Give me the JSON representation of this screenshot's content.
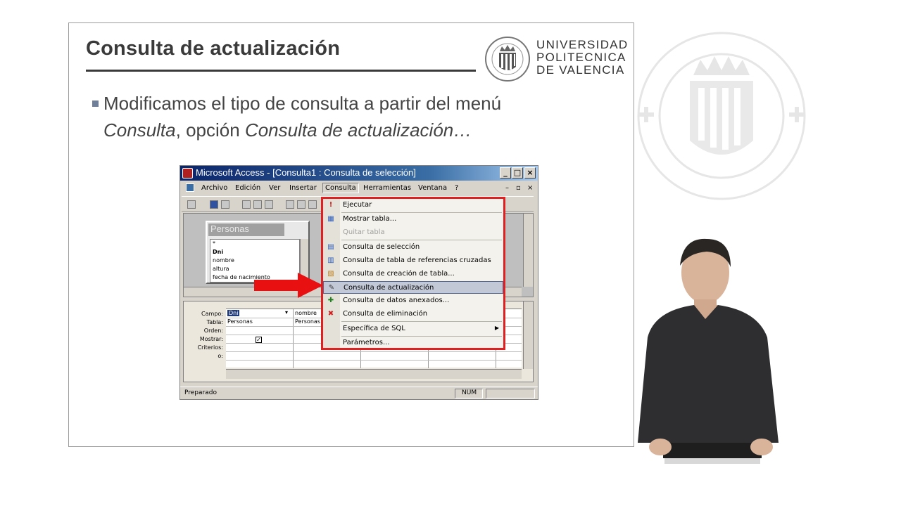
{
  "slide": {
    "title": "Consulta de actualización",
    "university": {
      "line1": "UNIVERSIDAD",
      "line2": "POLITECNICA",
      "line3": "DE VALENCIA"
    },
    "bullet": {
      "part1": "Modificamos el tipo de consulta a partir del menú",
      "menu_name": "Consulta",
      "part2": ", opción",
      "option_name": "Consulta de actualización…"
    }
  },
  "access": {
    "window_title": "Microsoft Access - [Consulta1 : Consulta de selección]",
    "window_buttons": {
      "minimize": "_",
      "maximize": "□",
      "close": "×"
    },
    "menubar": [
      "Archivo",
      "Edición",
      "Ver",
      "Insertar",
      "Consulta",
      "Herramientas",
      "Ventana",
      "?"
    ],
    "active_menu": "Consulta",
    "table_box": {
      "title": "Personas",
      "fields": [
        "*",
        "Dni",
        "nombre",
        "altura",
        "fecha de nacimiento"
      ]
    },
    "grid": {
      "row_labels": [
        "Campo:",
        "Tabla:",
        "Orden:",
        "Mostrar:",
        "Criterios:",
        "o:"
      ],
      "col1": {
        "campo": "Dni",
        "tabla": "Personas"
      },
      "col2": {
        "campo": "nombre",
        "tabla": "Personas"
      },
      "mostrar_check": "✓"
    },
    "status": {
      "text": "Preparado",
      "num": "NUM"
    },
    "dropdown": [
      {
        "label": "Ejecutar",
        "icon": "exclamation-icon",
        "glyph": "!",
        "color": "#d02020"
      },
      {
        "label": "Mostrar tabla...",
        "icon": "show-table-icon",
        "glyph": "▦",
        "color": "#3060c0"
      },
      {
        "label": "Quitar tabla",
        "icon": "",
        "glyph": "",
        "color": "",
        "disabled": true
      },
      {
        "label": "Consulta de selección",
        "icon": "select-query-icon",
        "glyph": "▤",
        "color": "#3060c0"
      },
      {
        "label": "Consulta de tabla de referencias cruzadas",
        "icon": "crosstab-query-icon",
        "glyph": "▥",
        "color": "#3060c0"
      },
      {
        "label": "Consulta de creación de tabla...",
        "icon": "make-table-query-icon",
        "glyph": "▧",
        "color": "#c08020"
      },
      {
        "label": "Consulta de actualización",
        "icon": "update-query-icon",
        "glyph": "✎",
        "color": "#404040",
        "highlight": true
      },
      {
        "label": "Consulta de datos anexados...",
        "icon": "append-query-icon",
        "glyph": "✚",
        "color": "#208020"
      },
      {
        "label": "Consulta de eliminación",
        "icon": "delete-query-icon",
        "glyph": "✖",
        "color": "#d02020"
      },
      {
        "label": "Específica de SQL",
        "icon": "",
        "glyph": "",
        "color": "",
        "submenu": "▶"
      },
      {
        "label": "Parámetros...",
        "icon": "",
        "glyph": "",
        "color": ""
      }
    ]
  },
  "colors": {
    "highlight_border": "#e02020",
    "arrow": "#e81010"
  }
}
